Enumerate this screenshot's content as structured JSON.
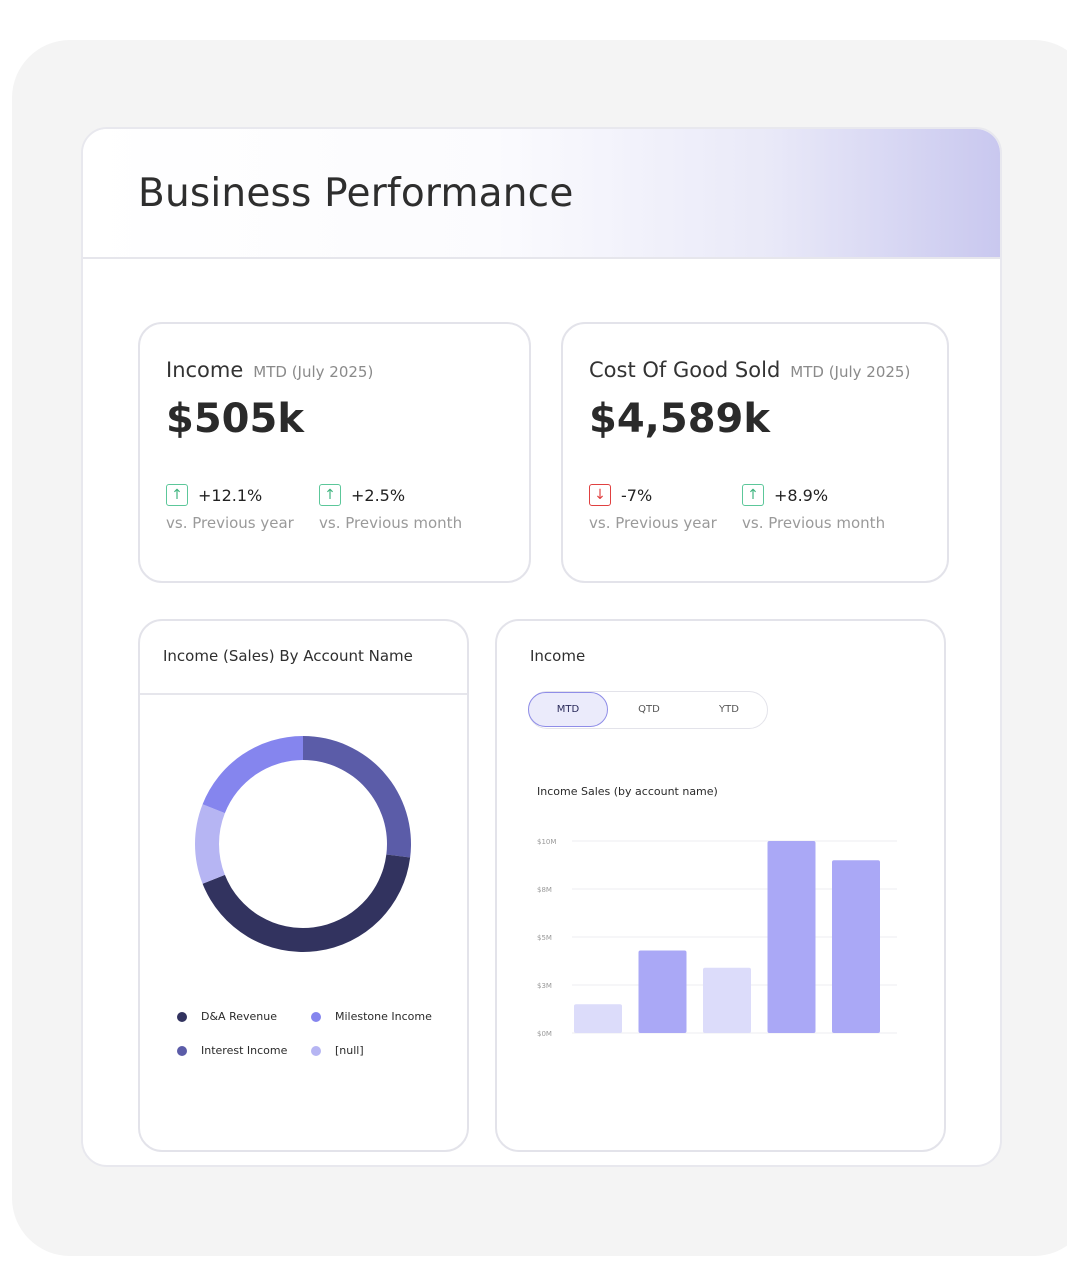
{
  "page": {
    "title": "Business Performance"
  },
  "kpis": [
    {
      "title": "Income",
      "period": "MTD (July 2025)",
      "value": "$505k",
      "deltas": [
        {
          "direction": "up",
          "value": "+12.1%",
          "label": "vs. Previous year"
        },
        {
          "direction": "up",
          "value": "+2.5%",
          "label": "vs. Previous month"
        }
      ]
    },
    {
      "title": "Cost Of Good Sold",
      "period": "MTD (July 2025)",
      "value": "$4,589k",
      "deltas": [
        {
          "direction": "down",
          "value": "-7%",
          "label": "vs. Previous year"
        },
        {
          "direction": "up",
          "value": "+8.9%",
          "label": "vs. Previous month"
        }
      ]
    }
  ],
  "donut_card": {
    "title": "Income (Sales) By Account Name",
    "legend": [
      {
        "label": "D&A Revenue",
        "color": "#32335f"
      },
      {
        "label": "Milestone Income",
        "color": "#8585ee"
      },
      {
        "label": "Interest Income",
        "color": "#5b5ca8"
      },
      {
        "label": "[null]",
        "color": "#b6b5f3"
      }
    ]
  },
  "bar_card": {
    "title": "Income",
    "tabs": [
      {
        "label": "MTD",
        "active": true
      },
      {
        "label": "QTD",
        "active": false
      },
      {
        "label": "YTD",
        "active": false
      }
    ],
    "chart_title": "Income Sales (by account name)"
  },
  "chart_data": [
    {
      "type": "pie",
      "donut": true,
      "categories": [
        "Interest Income",
        "D&A Revenue",
        "[null]",
        "Milestone Income"
      ],
      "values": [
        27,
        42,
        12,
        19
      ],
      "colors": [
        "#5b5ca8",
        "#32335f",
        "#b6b5f3",
        "#8585ee"
      ]
    },
    {
      "type": "bar",
      "title": "Income Sales (by account name)",
      "y_ticks": [
        "$10M",
        "$8M",
        "$5M",
        "$3M",
        "$0M"
      ],
      "ylim": [
        0,
        10
      ],
      "values": [
        1.5,
        4.3,
        3.4,
        10,
        9
      ],
      "colors": [
        "#dcdcfa",
        "#aaa8f6",
        "#dcdcfa",
        "#aaa8f6",
        "#aaa8f6"
      ]
    }
  ]
}
